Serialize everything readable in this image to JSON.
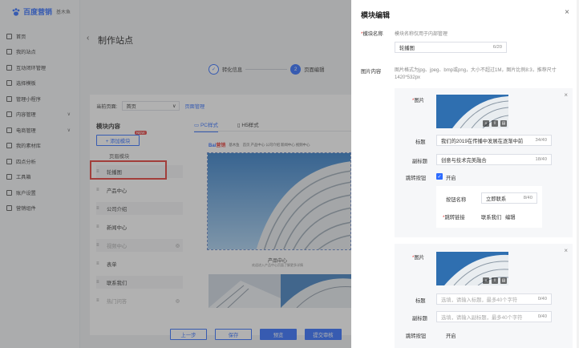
{
  "app": {
    "logo_main": "百度营销",
    "logo_sub": "基木鱼"
  },
  "sidebar": {
    "items": [
      {
        "label": "首页",
        "chev": ""
      },
      {
        "label": "我的站点",
        "chev": ""
      },
      {
        "label": "互动闭环管理",
        "chev": ""
      },
      {
        "label": "选择模板",
        "chev": ""
      },
      {
        "label": "管理小程序",
        "chev": ""
      },
      {
        "label": "内容管理",
        "chev": "∨"
      },
      {
        "label": "电商管理",
        "chev": "∨"
      },
      {
        "label": "我的素材库",
        "chev": ""
      },
      {
        "label": "四点分析",
        "chev": ""
      },
      {
        "label": "工具箱",
        "chev": ""
      },
      {
        "label": "账户设置",
        "chev": ""
      },
      {
        "label": "营销组件",
        "chev": ""
      }
    ]
  },
  "main": {
    "back": "‹",
    "title": "制作站点",
    "steps": [
      {
        "num": "✓",
        "label": "转化信息"
      },
      {
        "num": "2",
        "label": "页面编辑"
      }
    ],
    "current_page_label": "当前页面:",
    "current_page_value": "首页",
    "page_manage": "页面管理",
    "module_title": "模块内容",
    "tabs": [
      "PC样式",
      "H5样式"
    ],
    "add_module": "+ 添加模块",
    "new_badge": "NEW",
    "footer_module": "页眉模块",
    "modules": [
      {
        "label": "轮播图",
        "dim": false,
        "eye": ""
      },
      {
        "label": "产品中心",
        "dim": false,
        "eye": ""
      },
      {
        "label": "公司介绍",
        "dim": false,
        "eye": ""
      },
      {
        "label": "新闻中心",
        "dim": false,
        "eye": ""
      },
      {
        "label": "视频中心",
        "dim": true,
        "eye": "◎"
      },
      {
        "label": "表单",
        "dim": false,
        "eye": ""
      },
      {
        "label": "联系我们",
        "dim": false,
        "eye": ""
      },
      {
        "label": "热门问答",
        "dim": true,
        "eye": "◎"
      }
    ],
    "preview": {
      "logo_a": "Bai",
      "logo_b": "营销",
      "logo_c": "基木鱼",
      "nav": "首页  产品中心  公司介绍  新闻中心  视频中心",
      "product_center": "产品中心",
      "product_sub": "欢迎进入产品中心页面了解更多详情"
    },
    "buttons": {
      "prev": "上一步",
      "save": "保存",
      "preview": "预览",
      "submit": "提交审核"
    }
  },
  "drawer": {
    "title": "模块编辑",
    "close": "×",
    "module_name_label": "模块名称",
    "module_name_hint": "模块名称仅用于内部管理",
    "module_name_value": "轮播图",
    "module_name_count": "6/20",
    "image_content_label": "图片内容",
    "image_content_hint": "图片格式为jpg、jpeg、bmp或png，大小不超过1M，图片比例8:3，推荐尺寸1420*532px",
    "card1": {
      "image_label": "图片",
      "title_label": "标题",
      "title_value": "我们的2019在传播中发展在逐渐中前",
      "title_count": "34/40",
      "sub_label": "副标题",
      "sub_value": "创意与技术完美融合",
      "sub_count": "18/40",
      "jump_label": "跳转按钮",
      "jump_toggle": "开启",
      "btn_name_label": "按钮名称",
      "btn_name_value": "立即联系",
      "btn_name_count": "8/40",
      "link_label": "跳转链接",
      "link_value": "联系我们",
      "link_edit": "编辑"
    },
    "card2": {
      "image_label": "图片",
      "title_label": "标题",
      "title_placeholder": "选填，请输入标题，最多40个字符",
      "title_count": "0/40",
      "sub_label": "副标题",
      "sub_placeholder": "选填，请输入副标题，最多40个字符",
      "sub_count": "0/40",
      "jump_label": "跳转按钮",
      "jump_toggle": "开启"
    }
  }
}
